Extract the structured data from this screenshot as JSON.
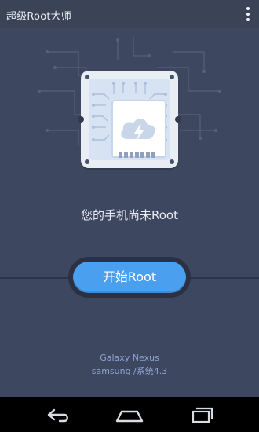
{
  "app": {
    "title": "超级Root大师"
  },
  "main": {
    "status": "您的手机尚未Root",
    "button_label": "开始Root"
  },
  "device": {
    "model": "Galaxy Nexus",
    "brand_os": "samsung /系统4.3"
  },
  "colors": {
    "background": "#3e4760",
    "appbar": "#3b4357",
    "button": "#4aa0ee",
    "device_text": "#8ea3d1"
  },
  "icons": [
    "overflow-menu-icon",
    "chip-icon",
    "cloud-lightning-icon",
    "back-icon",
    "home-icon",
    "recents-icon"
  ]
}
